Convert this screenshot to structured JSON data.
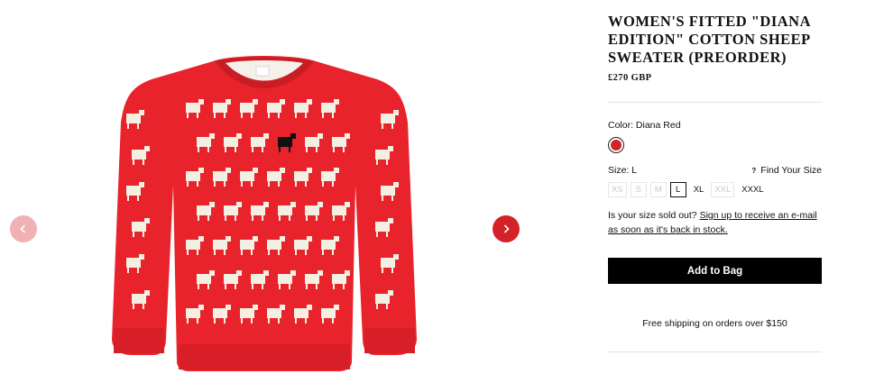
{
  "product": {
    "title": "WOMEN'S FITTED \"DIANA EDITION\" COTTON SHEEP SWEATER (PREORDER)",
    "price": "£270 GBP",
    "image_icon": "red-sheep-sweater-image"
  },
  "color": {
    "label": "Color: Diana Red",
    "swatch_hex": "#d42229"
  },
  "size": {
    "label": "Size: L",
    "guide_icon": "?",
    "guide_label": "Find Your Size",
    "options": [
      {
        "label": "XS",
        "state": "disabled"
      },
      {
        "label": "S",
        "state": "disabled"
      },
      {
        "label": "M",
        "state": "disabled"
      },
      {
        "label": "L",
        "state": "selected"
      },
      {
        "label": "XL",
        "state": "available"
      },
      {
        "label": "XXL",
        "state": "disabled"
      },
      {
        "label": "XXXL",
        "state": "available"
      }
    ]
  },
  "soldout": {
    "text": "Is your size sold out? ",
    "link": "Sign up to receive an e-mail as soon as it's back in stock."
  },
  "actions": {
    "add_to_bag": "Add to Bag"
  },
  "shipping": {
    "text": "Free shipping on orders over $150"
  },
  "colors": {
    "accent": "#d42229",
    "button_bg": "#000000",
    "sweater_red": "#e8232b",
    "sheep_cream": "#f4efe3"
  }
}
